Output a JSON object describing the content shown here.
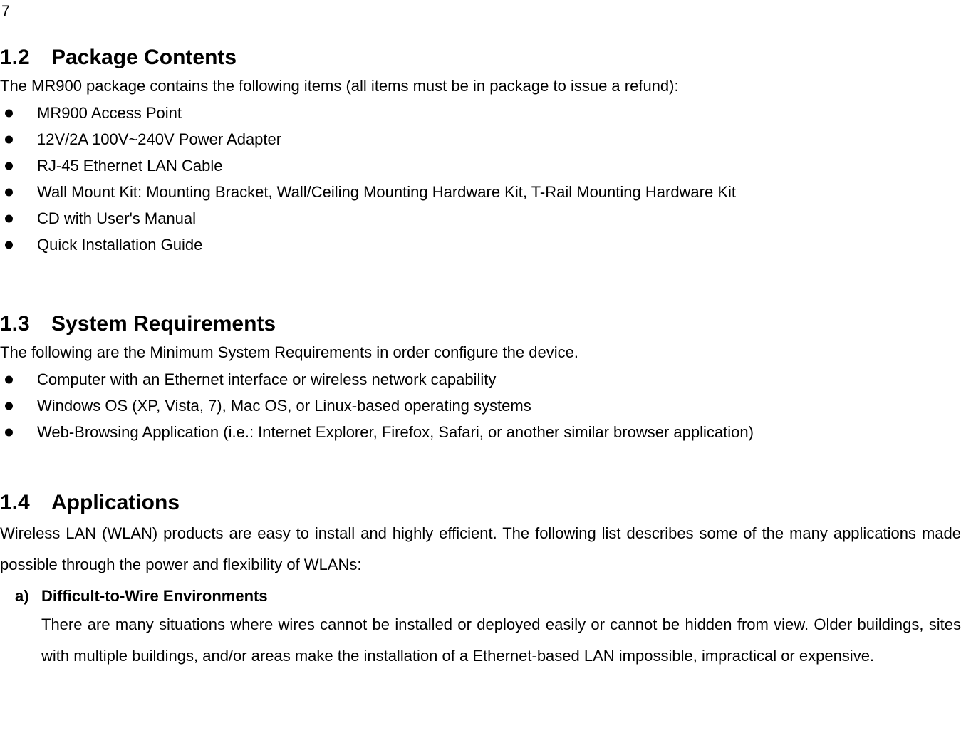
{
  "page": {
    "number": "7"
  },
  "sections": [
    {
      "number": "1.2",
      "title": "Package Contents",
      "lead": "The MR900 package contains the following items (all items must be in package to issue a refund):",
      "bullets": [
        "MR900 Access Point",
        "12V/2A 100V~240V Power Adapter",
        "RJ-45 Ethernet LAN Cable",
        "Wall Mount Kit: Mounting Bracket, Wall/Ceiling Mounting Hardware Kit, T-Rail Mounting Hardware Kit",
        "CD with User's Manual",
        "Quick Installation Guide"
      ]
    },
    {
      "number": "1.3",
      "title": "System Requirements",
      "lead": "The following are the Minimum System Requirements in order configure the device.",
      "bullets": [
        "Computer with an Ethernet interface or wireless network capability",
        "Windows OS (XP, Vista, 7), Mac OS, or Linux-based operating systems",
        "Web-Browsing Application (i.e.: Internet Explorer, Firefox, Safari, or another similar browser application)"
      ]
    },
    {
      "number": "1.4",
      "title": "Applications",
      "paragraph": "Wireless LAN (WLAN) products are easy to install and highly efficient. The following list describes some of the many applications made possible through the power and flexibility of WLANs:",
      "items": [
        {
          "marker": "a)",
          "title": "Difficult-to-Wire Environments",
          "body": "There are many situations where wires cannot be installed or deployed easily or cannot be hidden from view. Older buildings, sites with multiple buildings, and/or areas make the installation of a Ethernet-based LAN impossible, impractical or expensive."
        }
      ]
    }
  ]
}
